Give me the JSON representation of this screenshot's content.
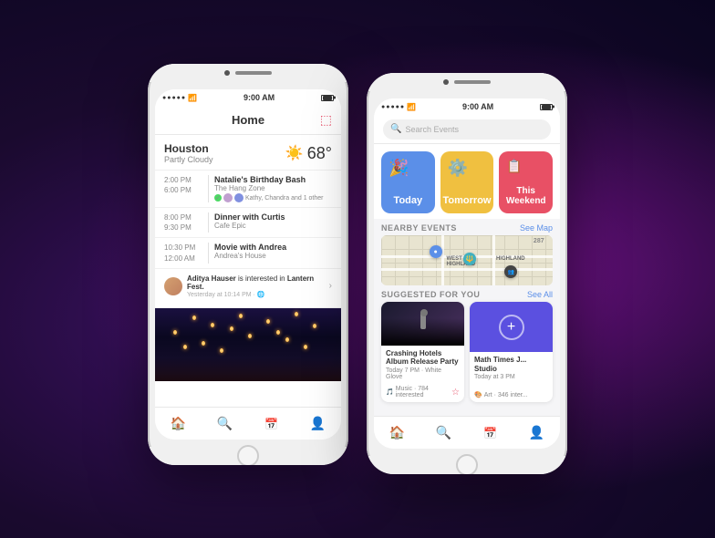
{
  "background": "#1a0a2e",
  "phone1": {
    "status": {
      "signal": "●●●●●",
      "wifi": "WiFi",
      "time": "9:00 AM",
      "battery": "full"
    },
    "header": {
      "title": "Home",
      "icon": "📥"
    },
    "weather": {
      "city": "Houston",
      "condition": "Partly Cloudy",
      "temp": "68°",
      "icon": "☀️"
    },
    "events": [
      {
        "start": "2:00 PM",
        "end": "6:00 PM",
        "title": "Natalie's Birthday Bash",
        "location": "The Hang Zone",
        "attendees": "Kathy, Chandra and 1 other"
      },
      {
        "start": "8:00 PM",
        "end": "9:30 PM",
        "title": "Dinner with Curtis",
        "location": "Cafe Epic",
        "attendees": null
      },
      {
        "start": "10:30 PM",
        "end": "12:00 AM",
        "title": "Movie with Andrea",
        "location": "Andrea's House",
        "attendees": null
      }
    ],
    "social_post": {
      "user": "Aditya Hauser",
      "action": "is interested in",
      "event": "Lantern Fest.",
      "time": "Yesterday at 10:14 PM",
      "icon": "🌐"
    },
    "tabs": [
      {
        "icon": "🏠",
        "label": "home",
        "active": true
      },
      {
        "icon": "🔍",
        "label": "search",
        "active": false
      },
      {
        "icon": "📅",
        "label": "calendar",
        "active": false
      },
      {
        "icon": "👤",
        "label": "profile",
        "active": false
      }
    ]
  },
  "phone2": {
    "status": {
      "signal": "●●●●●",
      "wifi": "WiFi",
      "time": "9:00 AM",
      "battery": "full"
    },
    "search": {
      "placeholder": "Search Events"
    },
    "filters": [
      {
        "label": "Today",
        "color": "#5b8fe8",
        "icon": "🎉",
        "key": "today"
      },
      {
        "label": "Tomorrow",
        "color": "#f0c040",
        "icon": "⚙️",
        "key": "tomorrow"
      },
      {
        "label": "This Weekend",
        "color": "#e85065",
        "icon": "📋",
        "key": "weekend"
      }
    ],
    "nearby": {
      "title": "NEARBY EVENTS",
      "link": "See Map"
    },
    "suggested": {
      "title": "SUGGESTED FOR YOU",
      "link": "See All",
      "events": [
        {
          "title": "Crashing Hotels Album Release Party",
          "meta": "Today 7 PM · White Glove",
          "tag": "Music · 784 interested",
          "type": "concert"
        },
        {
          "title": "Math Times J... Studio",
          "meta": "Today at 3 PM",
          "tag": "Art · 346 inter...",
          "type": "math"
        }
      ]
    },
    "tabs": [
      {
        "icon": "🏠",
        "label": "home",
        "active": false
      },
      {
        "icon": "🔍",
        "label": "search",
        "active": true
      },
      {
        "icon": "📅",
        "label": "calendar",
        "active": false
      },
      {
        "icon": "👤",
        "label": "profile",
        "active": false
      }
    ]
  }
}
